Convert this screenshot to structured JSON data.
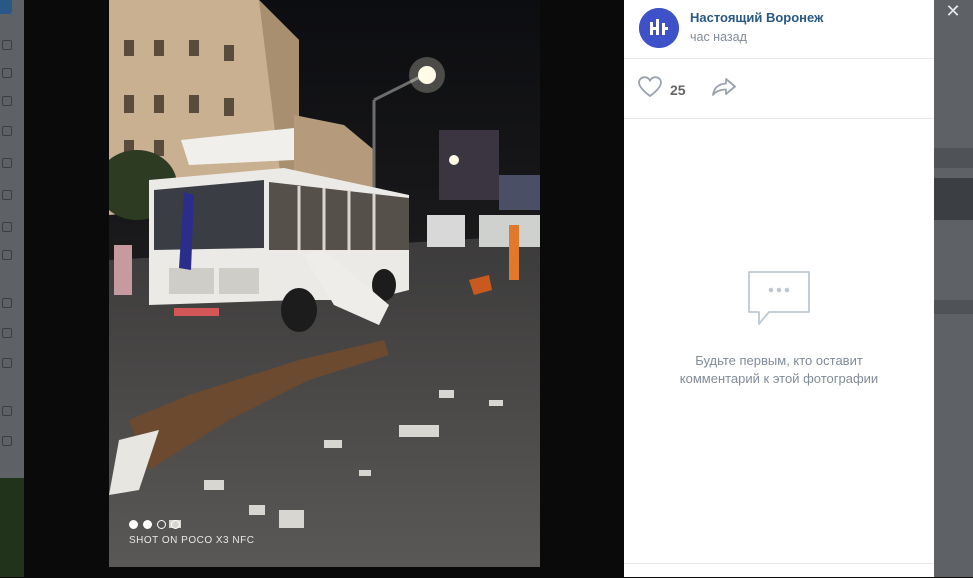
{
  "post": {
    "author_name": "Настоящий Воронеж",
    "time": "час назад"
  },
  "actions": {
    "likes": "25"
  },
  "comments": {
    "empty_text_line1": "Будьте первым, кто оставит",
    "empty_text_line2": "комментарий к этой фотографии"
  },
  "photo": {
    "watermark": "SHOT ON POCO X3 NFC",
    "carousel_total": 4,
    "carousel_active": 2
  },
  "colors": {
    "link": "#2a5885",
    "muted": "#818c99",
    "avatar": "#3f51c8"
  },
  "icons": [
    "close-icon",
    "heart-icon",
    "share-icon",
    "comment-bubble-icon"
  ]
}
